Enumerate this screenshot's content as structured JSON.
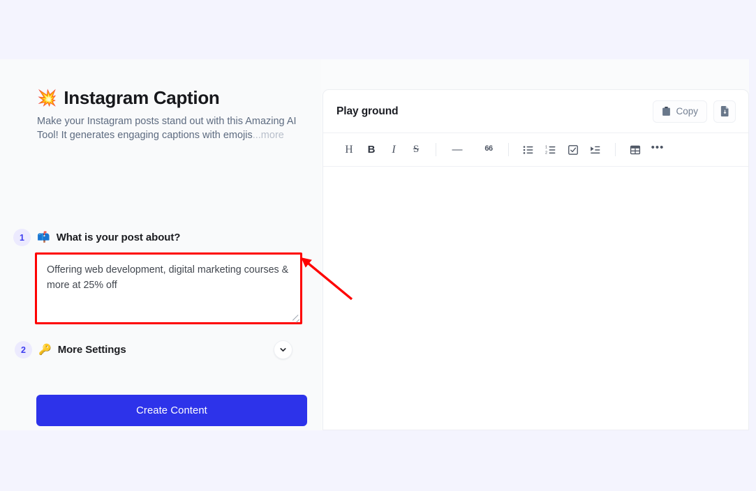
{
  "page": {
    "background_color": "#f4f4fe",
    "canvas_color": "#fafbfc"
  },
  "hero": {
    "emoji": "💥",
    "emoji_name": "collision-icon",
    "title": "Instagram Caption",
    "description": "Make your Instagram posts stand out with this Amazing AI Tool! It generates engaging captions with emojis",
    "more_label": "...more"
  },
  "form": {
    "step1": {
      "number": "1",
      "emoji": "📫",
      "emoji_name": "mailbox-icon",
      "label": "What is your post about?",
      "textarea_value": "Offering web development, digital marketing courses & more at 25% off",
      "textarea_placeholder": "",
      "highlight_color": "#fe0000"
    },
    "step2": {
      "number": "2",
      "emoji": "🔑",
      "emoji_name": "key-icon",
      "label": "More Settings",
      "expanded": "false"
    },
    "submit_label": "Create Content",
    "submit_color": "#2d33ea"
  },
  "playground": {
    "title": "Play ground",
    "copy_label": "Copy",
    "download_label": "",
    "toolbar": [
      {
        "name": "heading",
        "glyph": "H",
        "cls": "glyph-h"
      },
      {
        "name": "bold",
        "glyph": "B",
        "cls": "glyph-b"
      },
      {
        "name": "italic",
        "glyph": "I",
        "cls": "glyph-i"
      },
      {
        "name": "strikethrough",
        "glyph": "S",
        "cls": "glyph-s"
      },
      {
        "name": "separator",
        "glyph": "",
        "cls": ""
      },
      {
        "name": "horizontal-rule",
        "glyph": "—",
        "cls": "glyph-hr"
      },
      {
        "name": "blockquote",
        "glyph": "66",
        "cls": "glyph-q"
      },
      {
        "name": "separator",
        "glyph": "",
        "cls": ""
      },
      {
        "name": "bullet-list",
        "glyph": "",
        "cls": ""
      },
      {
        "name": "numbered-list",
        "glyph": "",
        "cls": ""
      },
      {
        "name": "checklist",
        "glyph": "",
        "cls": ""
      },
      {
        "name": "indent",
        "glyph": "",
        "cls": ""
      },
      {
        "name": "separator",
        "glyph": "",
        "cls": ""
      },
      {
        "name": "table",
        "glyph": "",
        "cls": ""
      },
      {
        "name": "more-options",
        "glyph": "•••",
        "cls": "glyph-dots"
      }
    ],
    "editor_content": ""
  },
  "annotation": {
    "arrow_color": "#fe0000",
    "arrow_from_x": "504",
    "arrow_from_y": "429",
    "arrow_to_x": "431",
    "arrow_to_y": "369"
  }
}
